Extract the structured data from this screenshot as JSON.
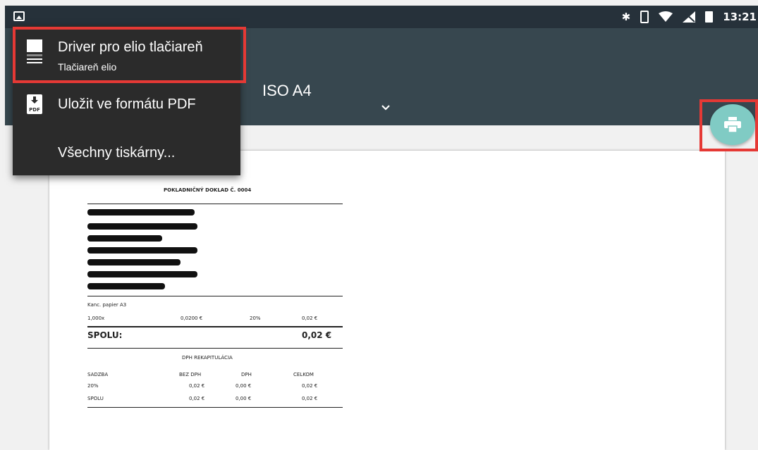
{
  "status_bar": {
    "time": "13:21",
    "icons": [
      "image-icon",
      "bluetooth-icon",
      "vibrate-icon",
      "wifi-icon",
      "no-signal-icon",
      "battery-charging-icon"
    ]
  },
  "print_settings": {
    "paper_size_label": ":",
    "paper_size_value": "ISO A4"
  },
  "printer_menu": {
    "items": [
      {
        "title": "Driver pro elio tlačiareň",
        "subtitle": "Tlačiareň elio",
        "icon": "printer-icon"
      },
      {
        "title": "Uložit ve formátu PDF",
        "icon": "pdf-icon"
      },
      {
        "title": "Všechny tiskárny..."
      }
    ]
  },
  "fab": {
    "icon": "print-icon",
    "color": "#80cbc4"
  },
  "receipt": {
    "title": "POKLADNIČNÝ DOKLAD Č. 0004",
    "item_name": "Kanc. papier A3",
    "item_row": [
      "1,000x",
      "0,0200 €",
      "20%",
      "0,02 €"
    ],
    "total_label": "SPOLU:",
    "total_value": "0,02 €",
    "vat_title": "DPH REKAPITULÁCIA",
    "vat_headers": [
      "SADZBA",
      "BEZ DPH",
      "DPH",
      "CELKOM"
    ],
    "vat_rows": [
      [
        "20%",
        "0,02 €",
        "0,00 €",
        "0,02 €"
      ],
      [
        "SPOLU",
        "0,02 €",
        "0,00 €",
        "0,02 €"
      ]
    ]
  },
  "colors": {
    "app_bar": "#37474f",
    "status_bar": "#26313a",
    "highlight": "#e53935",
    "menu_bg": "#2b2b2b"
  }
}
